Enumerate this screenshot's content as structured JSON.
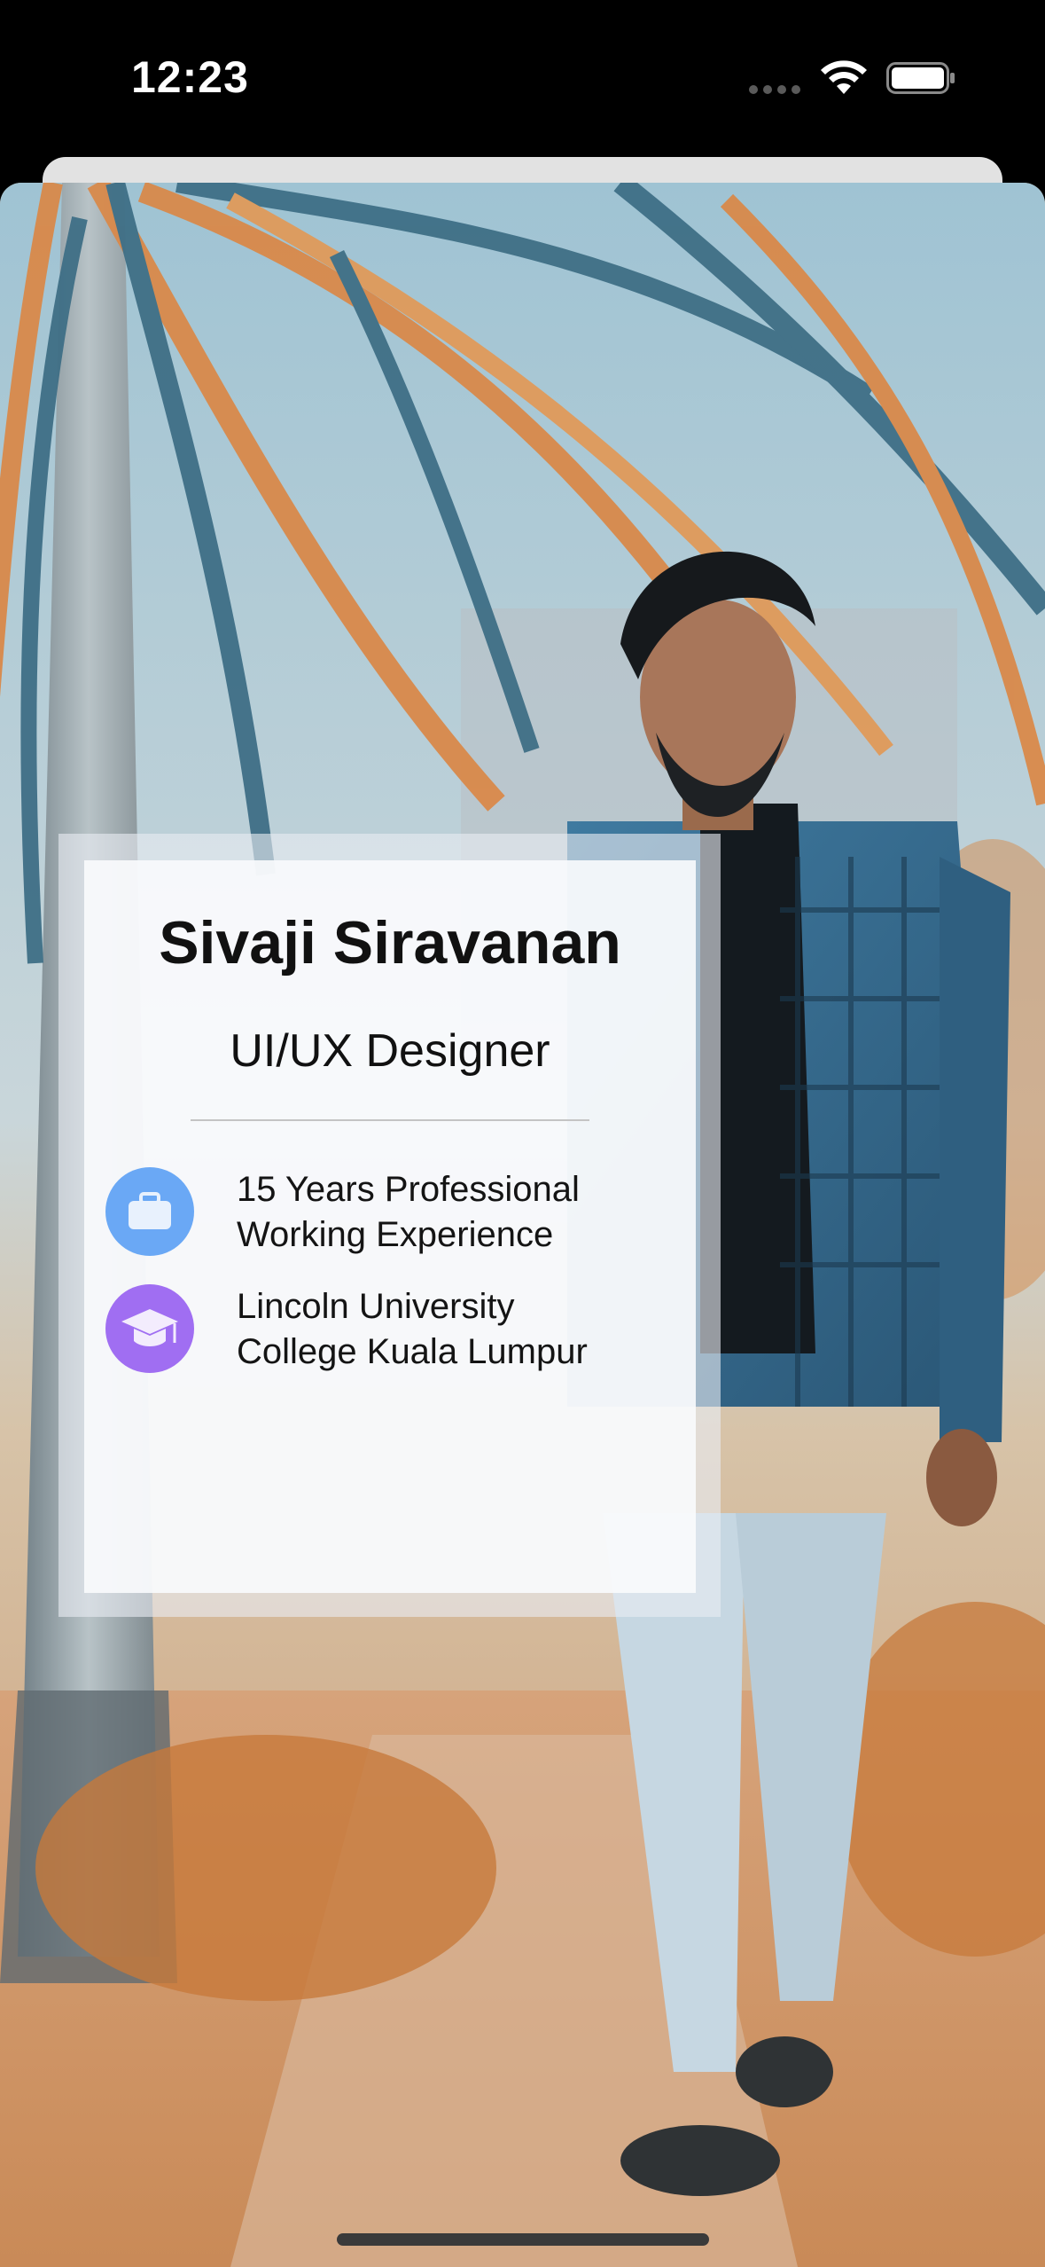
{
  "status_bar": {
    "time": "12:23",
    "icons": [
      "signal-dots-icon",
      "wifi-icon",
      "battery-icon"
    ]
  },
  "profile": {
    "name": "Sivaji Siravanan",
    "role": "UI/UX Designer",
    "details": [
      {
        "icon": "briefcase-icon",
        "icon_color": "#6aa8f5",
        "line1": "15 Years Professional",
        "line2": "Working Experience"
      },
      {
        "icon": "graduation-cap-icon",
        "icon_color": "#a06ef2",
        "line1": "Lincoln University",
        "line2": "College Kuala Lumpur"
      }
    ]
  },
  "colors": {
    "status_bar_bg": "#000000",
    "sheet_back": "#e2e2e2",
    "card_bg": "#fafbfd",
    "text": "#111111",
    "divider": "#c4c4c4",
    "photo_orange": "#d9894a",
    "photo_teal": "#3f6f86"
  }
}
